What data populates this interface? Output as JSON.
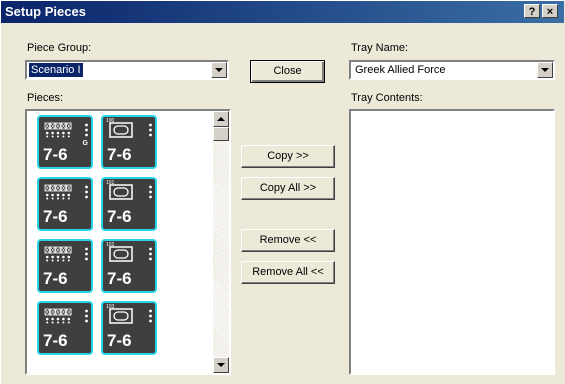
{
  "window": {
    "title": "Setup Pieces",
    "help_glyph": "?",
    "close_glyph": "×"
  },
  "piece_group": {
    "label": "Piece Group:",
    "value": "Scenario I"
  },
  "tray_name": {
    "label": "Tray Name:",
    "value": "Greek Allied Force"
  },
  "pieces": {
    "label": "Pieces:",
    "items": [
      {
        "type": "infantry",
        "factors": "7-6",
        "sup": "G",
        "num": ""
      },
      {
        "type": "armor",
        "factors": "7-6",
        "sup": "",
        "num": "100"
      },
      {
        "type": "infantry",
        "factors": "7-6",
        "sup": "",
        "num": ""
      },
      {
        "type": "armor",
        "factors": "7-6",
        "sup": "",
        "num": "101"
      },
      {
        "type": "infantry",
        "factors": "7-6",
        "sup": "",
        "num": ""
      },
      {
        "type": "armor",
        "factors": "7-6",
        "sup": "",
        "num": "102"
      },
      {
        "type": "infantry",
        "factors": "7-6",
        "sup": "",
        "num": ""
      },
      {
        "type": "armor",
        "factors": "7-6",
        "sup": "",
        "num": "103"
      }
    ]
  },
  "tray_contents": {
    "label": "Tray Contents:"
  },
  "buttons": {
    "close": "Close",
    "copy": "Copy >>",
    "copy_all": "Copy All >>",
    "remove": "Remove <<",
    "remove_all": "Remove All <<"
  },
  "colors": {
    "title_gradient_start": "#0a246a",
    "piece_border": "#2bd3e6",
    "piece_fill": "#3f3f3f"
  }
}
